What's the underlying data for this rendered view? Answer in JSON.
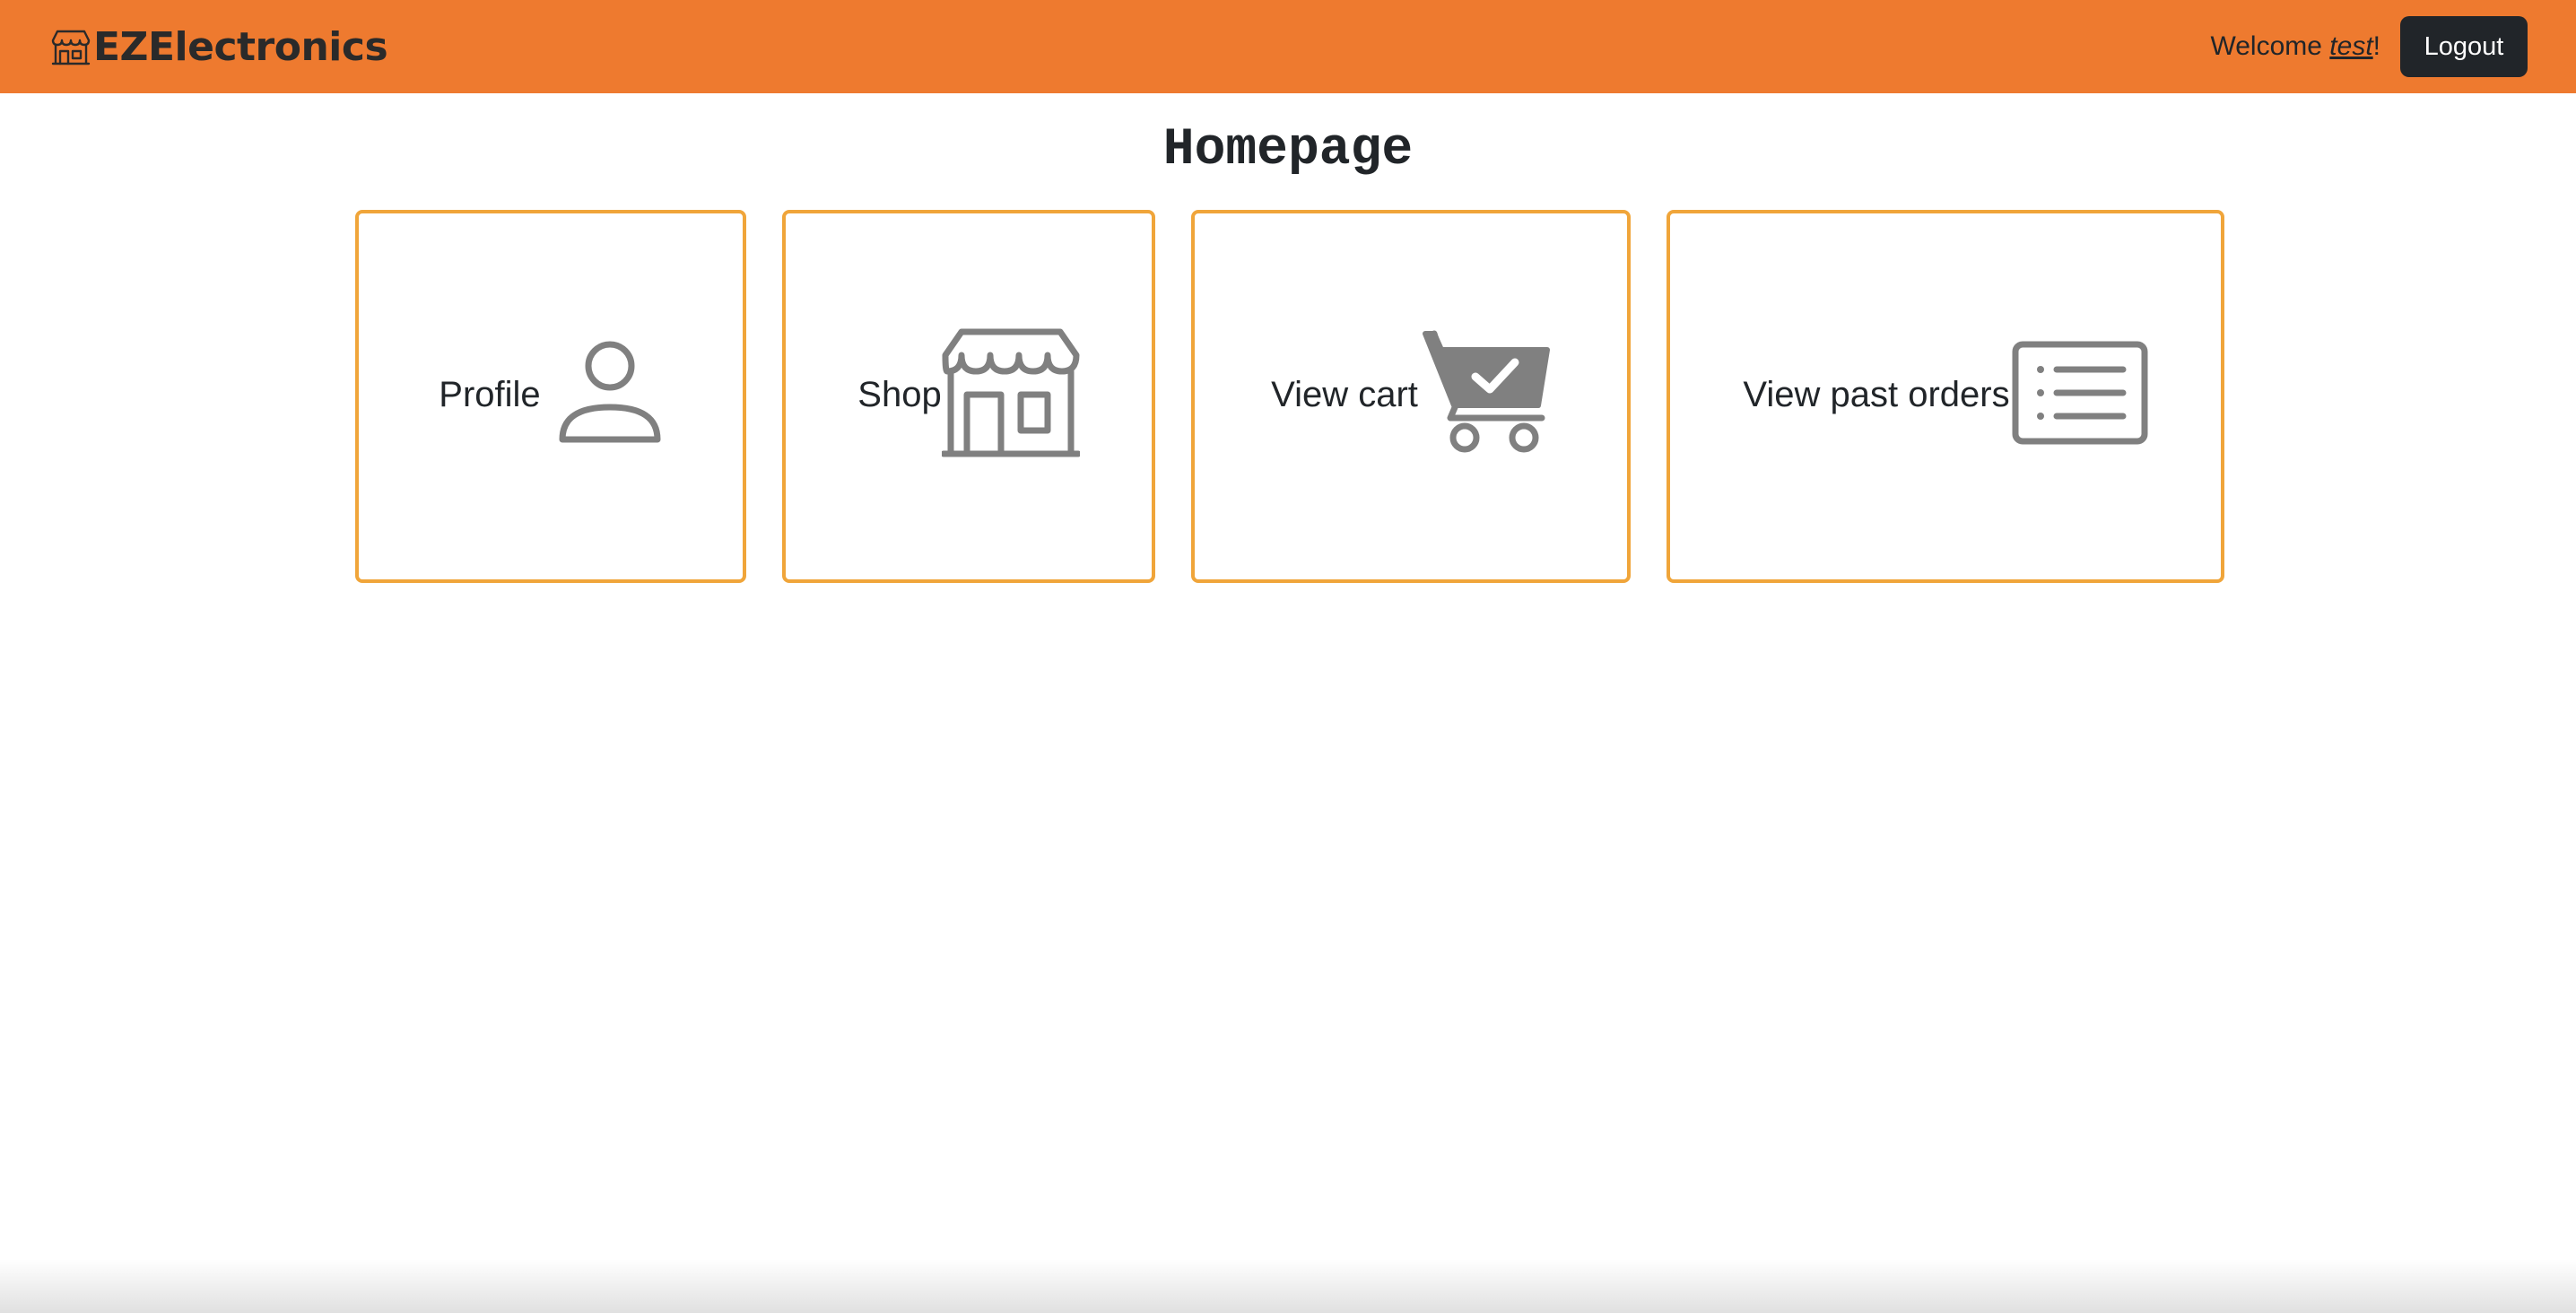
{
  "navbar": {
    "brand_icon": "store-icon",
    "brand_name": "EZElectronics",
    "welcome_prefix": "Welcome ",
    "username": "test",
    "welcome_suffix": "!",
    "logout_label": "Logout",
    "background_color": "#ee7a2f"
  },
  "page": {
    "title": "Homepage"
  },
  "cards": [
    {
      "label": "Profile",
      "icon": "person-icon"
    },
    {
      "label": "Shop",
      "icon": "shop-icon"
    },
    {
      "label": "View cart",
      "icon": "cart-check-icon"
    },
    {
      "label": "View past orders",
      "icon": "list-icon"
    }
  ],
  "colors": {
    "card_border": "#f0a53a",
    "icon_gray": "#808080",
    "dark_button": "#212529"
  }
}
